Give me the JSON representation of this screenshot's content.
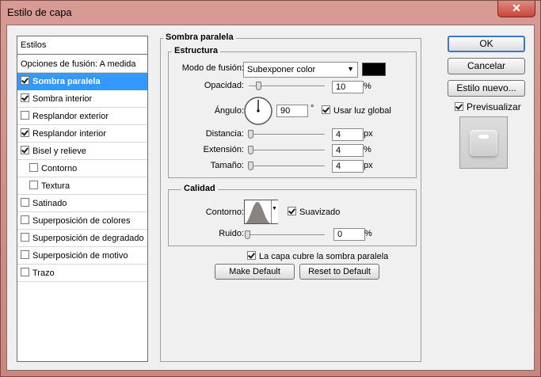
{
  "window": {
    "title": "Estilo de capa"
  },
  "sidebar": {
    "header": "Estilos",
    "blend_options": "Opciones de fusión: A medida",
    "items": [
      {
        "label": "Sombra paralela",
        "checked": true,
        "selected": true,
        "indent": false
      },
      {
        "label": "Sombra interior",
        "checked": true,
        "selected": false,
        "indent": false
      },
      {
        "label": "Resplandor exterior",
        "checked": false,
        "selected": false,
        "indent": false
      },
      {
        "label": "Resplandor interior",
        "checked": true,
        "selected": false,
        "indent": false
      },
      {
        "label": "Bisel y relieve",
        "checked": true,
        "selected": false,
        "indent": false
      },
      {
        "label": "Contorno",
        "checked": false,
        "selected": false,
        "indent": true
      },
      {
        "label": "Textura",
        "checked": false,
        "selected": false,
        "indent": true
      },
      {
        "label": "Satinado",
        "checked": false,
        "selected": false,
        "indent": false
      },
      {
        "label": "Superposición de colores",
        "checked": false,
        "selected": false,
        "indent": false
      },
      {
        "label": "Superposición de degradado",
        "checked": false,
        "selected": false,
        "indent": false
      },
      {
        "label": "Superposición de motivo",
        "checked": false,
        "selected": false,
        "indent": false
      },
      {
        "label": "Trazo",
        "checked": false,
        "selected": false,
        "indent": false
      }
    ]
  },
  "main": {
    "section_title": "Sombra paralela",
    "structure": {
      "title": "Estructura",
      "blend_mode_label": "Modo de fusión:",
      "blend_mode_value": "Subexponer color",
      "blend_color": "#000000",
      "opacity_label": "Opacidad:",
      "opacity_value": "10",
      "opacity_unit": "%",
      "opacity_fraction": 0.1,
      "angle_label": "Ángulo:",
      "angle_value": "90",
      "angle_unit": "°",
      "global_light_label": "Usar luz global",
      "global_light_checked": true,
      "distance_label": "Distancia:",
      "distance_value": "4",
      "distance_unit": "px",
      "spread_label": "Extensión:",
      "spread_value": "4",
      "spread_unit": "%",
      "size_label": "Tamaño:",
      "size_value": "4",
      "size_unit": "px"
    },
    "quality": {
      "title": "Calidad",
      "contour_label": "Contorno:",
      "antialias_label": "Suavizado",
      "antialias_checked": true,
      "noise_label": "Ruido:",
      "noise_value": "0",
      "noise_unit": "%"
    },
    "knockout_label": "La capa cubre la sombra paralela",
    "knockout_checked": true,
    "make_default": "Make Default",
    "reset_default": "Reset to Default"
  },
  "actions": {
    "ok": "OK",
    "cancel": "Cancelar",
    "new_style": "Estilo nuevo...",
    "preview_label": "Previsualizar",
    "preview_checked": true
  }
}
